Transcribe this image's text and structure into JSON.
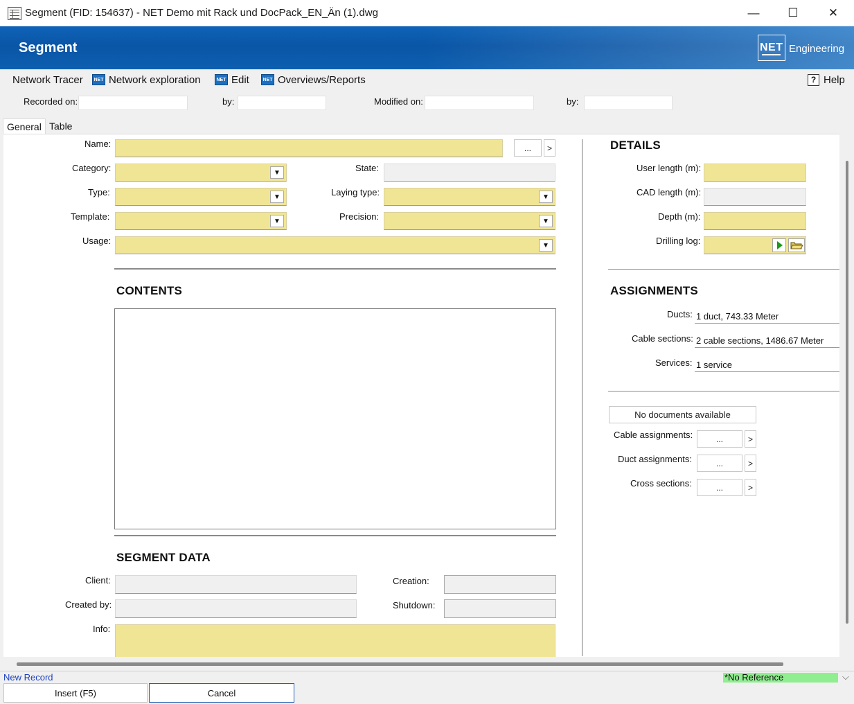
{
  "window": {
    "title": "Segment (FID: 154637) - NET Demo mit Rack und DocPack_EN_Än (1).dwg",
    "minimize": "—",
    "maximize": "☐",
    "close": "✕"
  },
  "banner": {
    "title": "Segment",
    "logo_net": "NET",
    "logo_text": "Engineering"
  },
  "menu": {
    "network_tracer": "Network Tracer",
    "network_exploration": "Network exploration",
    "edit": "Edit",
    "overviews": "Overviews/Reports",
    "help": "Help",
    "net_icon": "NET"
  },
  "record": {
    "recorded_on_label": "Recorded on:",
    "by_label": "by:",
    "modified_on_label": "Modified on:",
    "by2_label": "by:"
  },
  "tabs": {
    "general": "General",
    "table": "Table"
  },
  "form": {
    "name_label": "Name:",
    "category_label": "Category:",
    "type_label": "Type:",
    "template_label": "Template:",
    "usage_label": "Usage:",
    "state_label": "State:",
    "laying_type_label": "Laying type:",
    "precision_label": "Precision:",
    "ellipsis": "...",
    "arrow": ">",
    "dropdown": "▼"
  },
  "contents": {
    "title": "CONTENTS"
  },
  "segment_data": {
    "title": "SEGMENT DATA",
    "client_label": "Client:",
    "created_by_label": "Created by:",
    "info_label": "Info:",
    "creation_label": "Creation:",
    "shutdown_label": "Shutdown:"
  },
  "details": {
    "title": "DETAILS",
    "user_length_label": "User length (m):",
    "cad_length_label": "CAD length (m):",
    "depth_label": "Depth (m):",
    "drilling_log_label": "Drilling log:"
  },
  "assignments": {
    "title": "ASSIGNMENTS",
    "ducts_label": "Ducts:",
    "ducts_value": "1 duct, 743.33 Meter",
    "cable_sections_label": "Cable sections:",
    "cable_sections_value": "2 cable sections, 1486.67 Meter",
    "services_label": "Services:",
    "services_value": "1 service"
  },
  "documents": {
    "no_docs": "No documents available",
    "cable_assign_label": "Cable assignments:",
    "duct_assign_label": "Duct assignments:",
    "cross_sections_label": "Cross sections:"
  },
  "status": {
    "new_record": "New Record",
    "reference": "*No Reference",
    "chevron": "⌵"
  },
  "buttons": {
    "insert": "Insert (F5)",
    "cancel": "Cancel"
  },
  "colors": {
    "banner_blue": "#0a55a6",
    "required_field": "#f0e594",
    "reference_green": "#90ee90",
    "status_link": "#1a40c0"
  }
}
